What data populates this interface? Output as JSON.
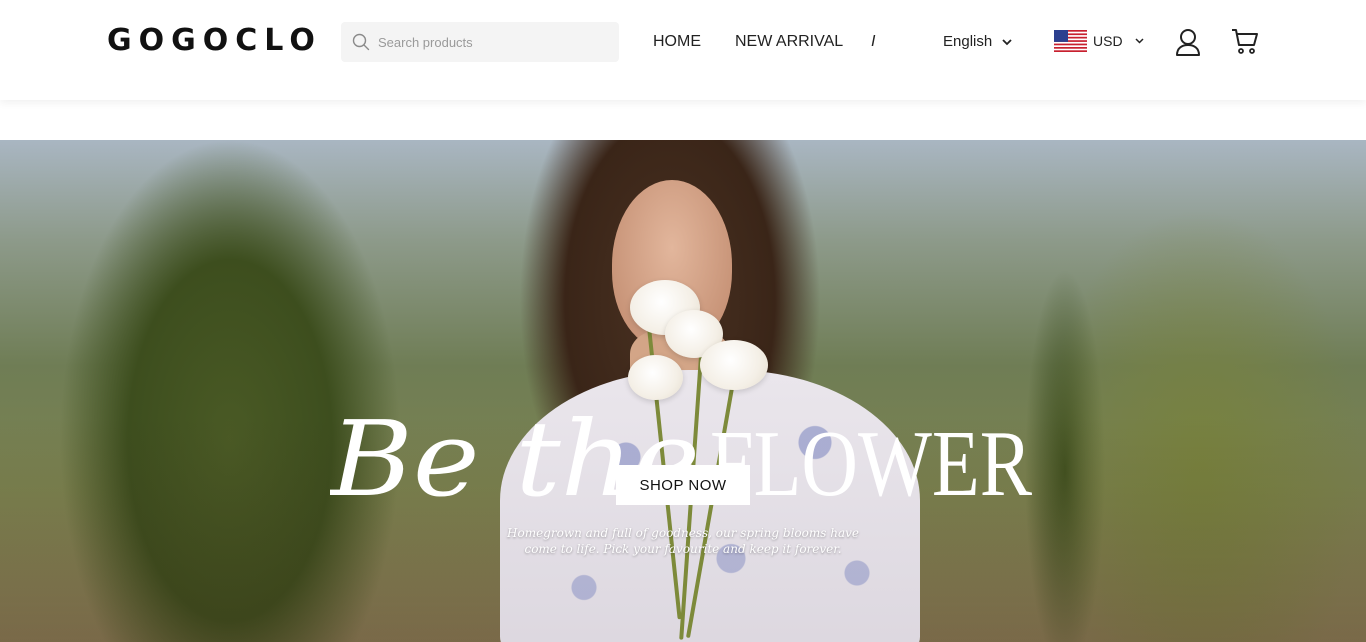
{
  "header": {
    "logo": "GOGOCLO",
    "search": {
      "placeholder": "Search products",
      "value": ""
    },
    "nav": [
      {
        "label": "HOME"
      },
      {
        "label": "NEW ARRIVAL"
      },
      {
        "label": "I"
      }
    ],
    "language": {
      "selected": "English"
    },
    "currency": {
      "selected": "USD",
      "flag": "us-flag-icon"
    },
    "icons": [
      "search-icon",
      "chevron-down-icon",
      "account-icon",
      "cart-icon"
    ]
  },
  "hero": {
    "slogan_script": "Be the",
    "slogan_serif": "FLOWER",
    "cta_label": "SHOP NOW",
    "subtitle_line1": "Homegrown and full of goodness, our spring blooms have",
    "subtitle_line2": "come to life. Pick your favourite and keep it forever."
  },
  "colors": {
    "text": "#222222",
    "search_bg": "#f4f4f4",
    "hero_text": "#ffffff"
  }
}
